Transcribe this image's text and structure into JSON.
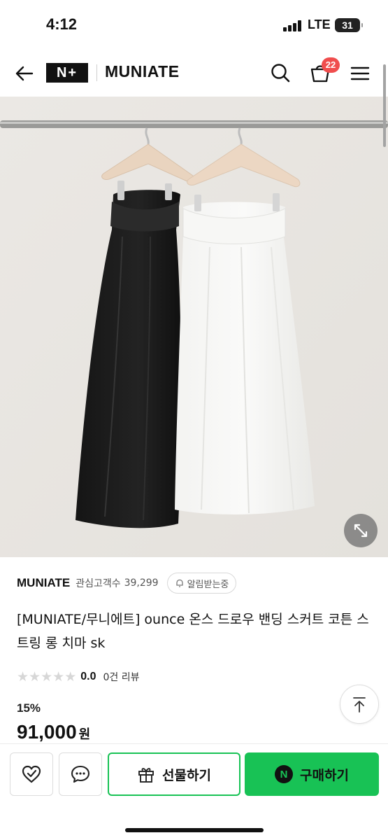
{
  "status_bar": {
    "time": "4:12",
    "network": "LTE",
    "battery": "31"
  },
  "nav": {
    "logo_text": "N+",
    "brand_title": "MUNIATE",
    "cart_count": "22",
    "icons": [
      "back-arrow-icon",
      "search-icon",
      "cart-icon",
      "menu-icon"
    ]
  },
  "product_image": {
    "alt": "black and white skirts on hangers"
  },
  "store": {
    "brand": "MUNIATE",
    "interest_label": "관심고객수",
    "interest_count": "39,299",
    "alert_label": "알림받는중"
  },
  "product": {
    "title": "[MUNIATE/무니에트] ounce 온스 드로우 밴딩 스커트 코튼 스트링 롱 치마 sk",
    "rating": "0.0",
    "star_count": 5,
    "review_text": "0건 리뷰",
    "discount": "15%",
    "price": "91,000",
    "price_unit": "원"
  },
  "actions": {
    "gift_label": "선물하기",
    "buy_label": "구매하기",
    "npay_mark": "N"
  },
  "colors": {
    "accent_green": "#18c255",
    "badge_red": "#f04d4d"
  }
}
